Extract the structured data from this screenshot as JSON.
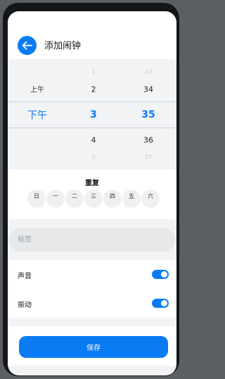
{
  "header": {
    "title": "添加闹钟"
  },
  "picker": {
    "ampm": {
      "prev": "上午",
      "selected": "下午"
    },
    "hours": {
      "prev2": "1",
      "prev": "2",
      "selected": "3",
      "next": "4",
      "next2": "5"
    },
    "minutes": {
      "prev2": "33",
      "prev": "34",
      "selected": "35",
      "next": "36",
      "next2": "37"
    }
  },
  "repeat": {
    "title": "重复",
    "days": [
      "日",
      "一",
      "二",
      "三",
      "四",
      "五",
      "六"
    ]
  },
  "label": {
    "placeholder": "标签",
    "value": ""
  },
  "settings": {
    "sound": {
      "label": "声音",
      "enabled": true
    },
    "vibrate": {
      "label": "振动",
      "enabled": true
    }
  },
  "footer": {
    "save_label": "保存"
  },
  "colors": {
    "accent": "#0a7cf3"
  }
}
